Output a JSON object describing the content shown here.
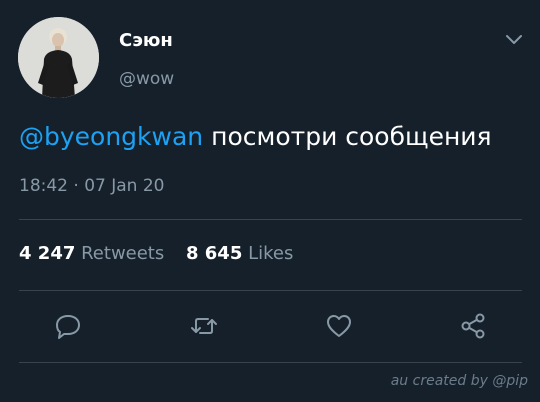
{
  "tweet": {
    "author_name": "Сэюн",
    "author_handle": "@wow",
    "mention": "@byeongkwan",
    "text": " посмотри сообщения",
    "timestamp": "18:42 · 07 Jan 20",
    "retweets_count": "4 247",
    "retweets_label": "Retweets",
    "likes_count": "8 645",
    "likes_label": "Likes"
  },
  "credit": "au created by @pip",
  "icons": [
    "chevron-down-icon",
    "reply-icon",
    "retweet-icon",
    "like-icon",
    "share-icon"
  ],
  "colors": {
    "background": "#15202b",
    "accent": "#1da1f2",
    "secondary_text": "#8899a6",
    "divider": "#38444d"
  }
}
